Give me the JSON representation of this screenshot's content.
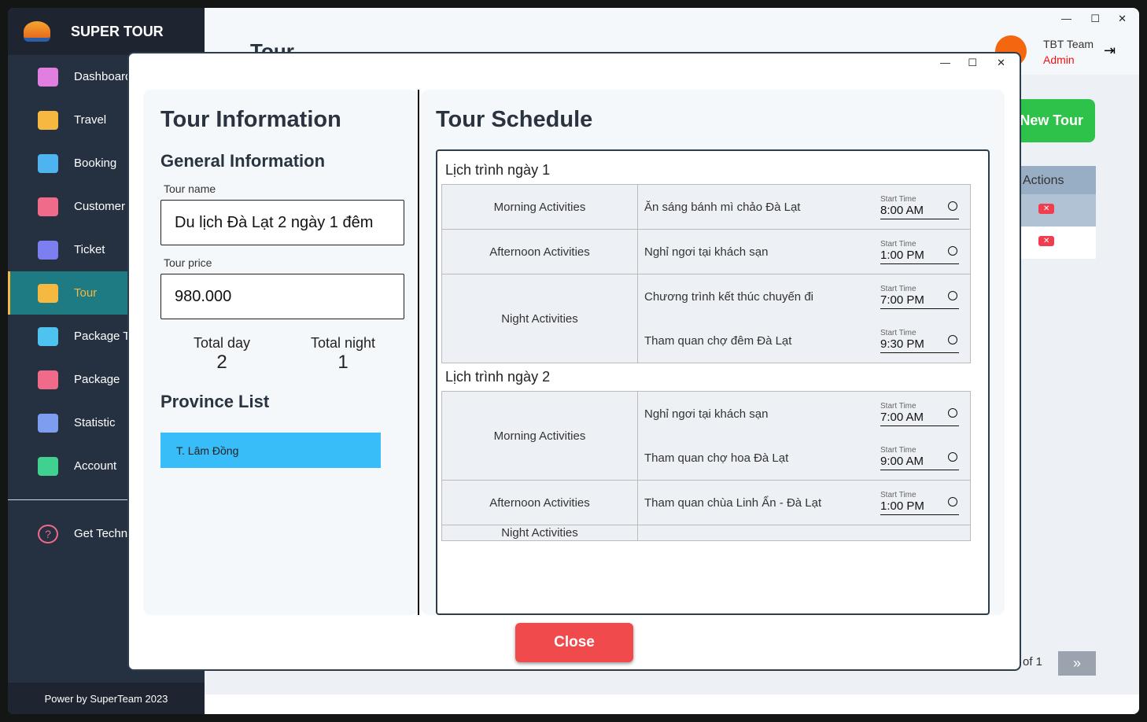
{
  "app": {
    "title": "SUPER TOUR",
    "footer": "Power by SuperTeam 2023"
  },
  "sidebar": {
    "items": [
      {
        "label": "Dashboard",
        "icon": "home-icon",
        "color": "#e07fe0"
      },
      {
        "label": "Travel",
        "icon": "plane-icon",
        "color": "#f5b840"
      },
      {
        "label": "Booking",
        "icon": "hand-icon",
        "color": "#4fb3f0"
      },
      {
        "label": "Customer",
        "icon": "contact-icon",
        "color": "#f06a8a"
      },
      {
        "label": "Ticket",
        "icon": "ticket-icon",
        "color": "#7d7ef0"
      },
      {
        "label": "Tour",
        "icon": "calendar-plus-icon",
        "color": "#f5b840"
      },
      {
        "label": "Package Type",
        "icon": "bag-icon",
        "color": "#4fc3f0"
      },
      {
        "label": "Package",
        "icon": "bag-icon",
        "color": "#f06a8a"
      },
      {
        "label": "Statistic",
        "icon": "database-icon",
        "color": "#7d9ef0"
      },
      {
        "label": "Account",
        "icon": "id-card-icon",
        "color": "#40d090"
      }
    ],
    "help": "Get Technical Help"
  },
  "header": {
    "page_title": "Tour",
    "user_name": "TBT Team",
    "user_role": "Admin"
  },
  "main": {
    "new_tour": "New Tour",
    "actions_header": "Actions",
    "pagination": "of 1"
  },
  "modal": {
    "info_title": "Tour Information",
    "general": "General Information",
    "tour_name_label": "Tour name",
    "tour_name": "Du lịch Đà Lạt 2 ngày 1 đêm",
    "tour_price_label": "Tour price",
    "tour_price": "980.000",
    "total_day_label": "Total day",
    "total_day": "2",
    "total_night_label": "Total night",
    "total_night": "1",
    "province_title": "Province List",
    "provinces": [
      "T. Lâm Đồng"
    ],
    "schedule_title": "Tour Schedule",
    "start_time_label": "Start Time",
    "close": "Close",
    "days": [
      {
        "title": "Lịch trình ngày 1",
        "groups": [
          {
            "name": "Morning Activities",
            "acts": [
              {
                "name": "Ăn sáng bánh mì chảo Đà Lạt",
                "time": "8:00 AM"
              }
            ]
          },
          {
            "name": "Afternoon Activities",
            "acts": [
              {
                "name": "Nghỉ ngơi tại khách sạn",
                "time": "1:00 PM"
              }
            ]
          },
          {
            "name": "Night Activities",
            "acts": [
              {
                "name": "Chương trình kết thúc chuyến đi",
                "time": "7:00 PM"
              },
              {
                "name": "Tham quan chợ đêm Đà Lạt",
                "time": "9:30 PM"
              }
            ]
          }
        ]
      },
      {
        "title": "Lịch trình ngày 2",
        "groups": [
          {
            "name": "Morning Activities",
            "acts": [
              {
                "name": "Nghỉ ngơi tại khách sạn",
                "time": "7:00 AM"
              },
              {
                "name": "Tham quan chợ hoa Đà Lạt",
                "time": "9:00 AM"
              }
            ]
          },
          {
            "name": "Afternoon Activities",
            "acts": [
              {
                "name": "Tham quan chùa Linh Ẩn - Đà Lạt",
                "time": "1:00 PM"
              }
            ]
          },
          {
            "name": "Night Activities",
            "acts": []
          }
        ]
      }
    ]
  }
}
